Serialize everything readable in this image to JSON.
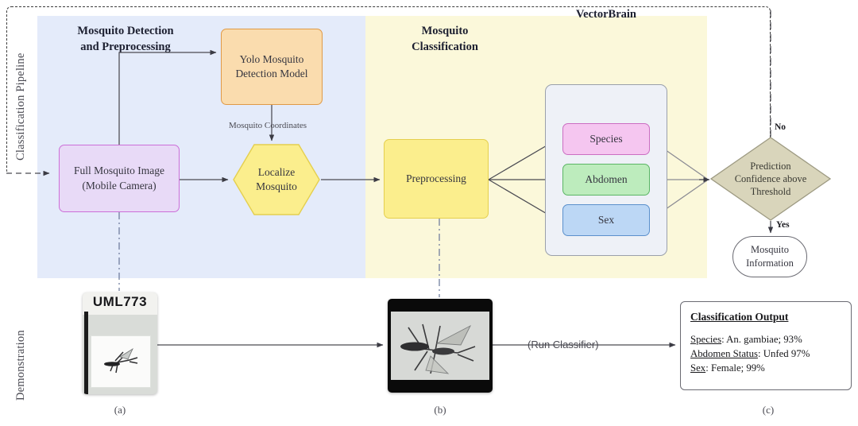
{
  "figure": {
    "side_labels": {
      "pipeline": "Classification Pipeline",
      "demonstration": "Demonstration"
    },
    "bands": [
      {
        "id": "detection",
        "title": "Mosquito Detection\nand Preprocessing",
        "title_line1": "Mosquito Detection",
        "title_line2": "and Preprocessing",
        "color": "#e4ebfa"
      },
      {
        "id": "classification",
        "title_line1": "Mosquito",
        "title_line2": "Classification",
        "color": "#fbf8da"
      }
    ],
    "nodes": {
      "yolo": {
        "line1": "Yolo Mosquito",
        "line2": "Detection Model",
        "fill": "#fadcae",
        "stroke": "#e09a46"
      },
      "full_image": {
        "line1": "Full Mosquito Image",
        "line2": "(Mobile Camera)",
        "fill": "#e8daf7",
        "stroke": "#cc6fd8"
      },
      "localize": {
        "line1": "Localize",
        "line2": "Mosquito",
        "fill": "#fbee8d",
        "stroke": "#e4cf4e"
      },
      "preprocessing": {
        "label": "Preprocessing",
        "fill": "#fbee8d",
        "stroke": "#e4cf4e"
      },
      "vectorbrain": {
        "title": "VectorBrain",
        "fill": "#eef1f7",
        "stroke": "#9aa0ab"
      },
      "species": {
        "label": "Species",
        "fill": "#f5c6f0",
        "stroke": "#cb6ec2"
      },
      "abdomen": {
        "label": "Abdomen",
        "fill": "#bdecbd",
        "stroke": "#5bb565"
      },
      "sex": {
        "label": "Sex",
        "fill": "#bcd7f5",
        "stroke": "#5b90cc"
      },
      "decision": {
        "line1": "Prediction",
        "line2": "Confidence above",
        "line3": "Threshold",
        "fill": "#d9d5bb",
        "stroke": "#9d9a82"
      },
      "mosquito_information": {
        "line1": "Mosquito",
        "line2": "Information",
        "fill": "#ffffff",
        "stroke": "#6a6a72"
      }
    },
    "edge_labels": {
      "mosquito_coordinates": "Mosquito Coordinates",
      "no": "No",
      "yes": "Yes",
      "run_classifier": "(Run Classifier)"
    },
    "demonstration": {
      "photo_a": {
        "tube_label": "UML773",
        "caption": "(a)"
      },
      "photo_b": {
        "caption": "(b)"
      },
      "output_card": {
        "caption": "(c)",
        "title": "Classification Output",
        "rows": [
          {
            "key": "Species",
            "value": ": An. gambiae; 93%"
          },
          {
            "key": "Abdomen Status",
            "value": ": Unfed 97%"
          },
          {
            "key": "Sex",
            "value": ": Female; 99%"
          }
        ]
      }
    }
  }
}
